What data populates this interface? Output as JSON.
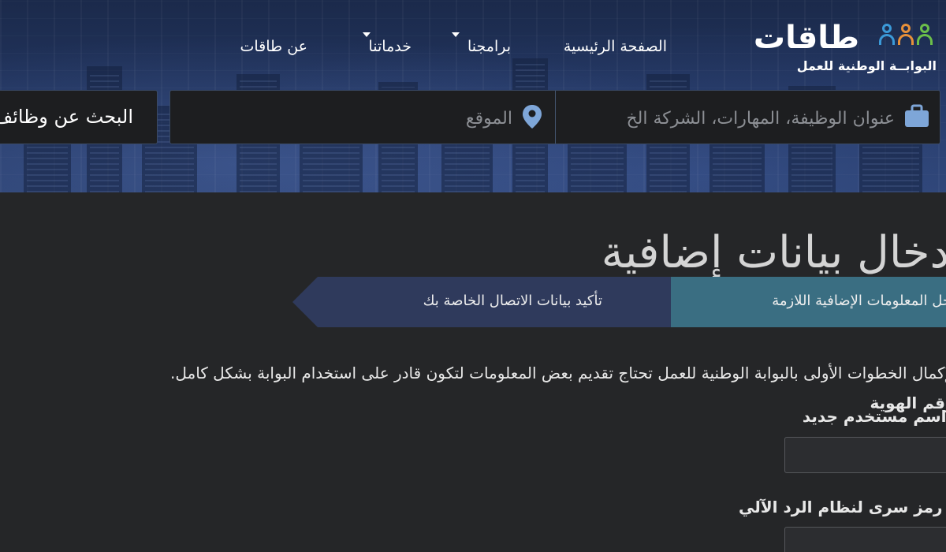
{
  "header": {
    "logo": {
      "brand": "طاقات",
      "tagline": "البوابــة الوطنية للعمل"
    },
    "nav": [
      {
        "label": "الصفحة الرئيسية",
        "dropdown": false
      },
      {
        "label": "برامجنا",
        "dropdown": true
      },
      {
        "label": "خدماتنا",
        "dropdown": true
      },
      {
        "label": "عن طاقات",
        "dropdown": false
      }
    ],
    "search": {
      "keyword_placeholder": "عنوان الوظيفة، المهارات، الشركة الخ",
      "location_placeholder": "الموقع",
      "button_label": "البحث عن وظائف"
    }
  },
  "main": {
    "title": "إدخال بيانات إضافية",
    "steps": [
      {
        "label": "أدخل المعلومات الإضافية اللازمة",
        "active": true
      },
      {
        "label": "تأكيد بيانات الاتصال الخاصة بك",
        "active": false
      }
    ],
    "intro": "لإكمال الخطوات الأولى بالبوابة الوطنية للعمل تحتاج تقديم بعض المعلومات لتكون قادر على استخدام البوابة بشكل كامل.",
    "fields": [
      {
        "label": "رقم الهوية",
        "required": true
      },
      {
        "label": "اسم مستخدم جديد",
        "required": true,
        "value": ""
      },
      {
        "label": "رمز سرى لنظام الرد الآلي",
        "required": true,
        "value": ""
      }
    ]
  },
  "colors": {
    "hero_bg": "#223560",
    "page_bg": "#252628",
    "step_active": "#3a6e82",
    "step_inactive": "#2f3a5c",
    "required": "#e0202a"
  },
  "icons": [
    "people-logo-icon",
    "caret-down-icon",
    "briefcase-icon",
    "map-pin-icon"
  ]
}
